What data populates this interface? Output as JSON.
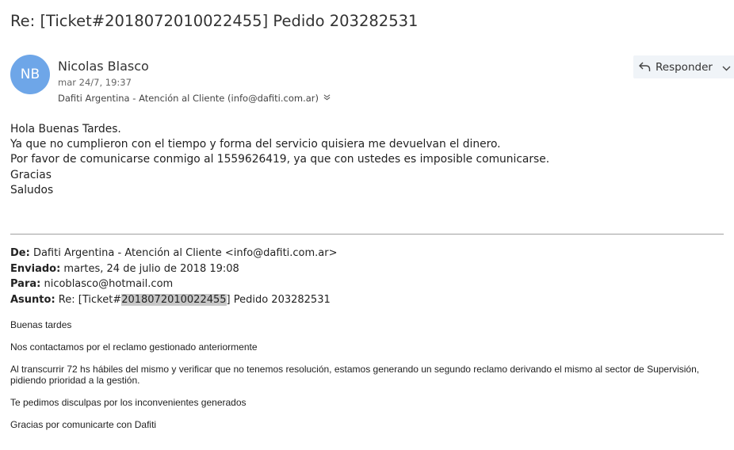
{
  "subject": "Re: [Ticket#2018072010022455] Pedido 203282531",
  "sender": {
    "initials": "NB",
    "name": "Nicolas Blasco",
    "date": "mar 24/7, 19:37",
    "to": "Dafiti Argentina - Atención al Cliente (info@dafiti.com.ar)"
  },
  "toolbar": {
    "reply_label": "Responder"
  },
  "body_lines": [
    "Hola Buenas Tardes.",
    "Ya que no cumplieron con el tiempo y forma del servicio quisiera me devuelvan el dinero.",
    "Por favor de comunicarse conmigo al 1559626419, ya que con ustedes es imposible comunicarse.",
    "Gracias",
    "Saludos"
  ],
  "quoted_header": {
    "from_label": "De:",
    "from_value": "Dafiti Argentina - Atención al Cliente <info@dafiti.com.ar>",
    "sent_label": "Enviado:",
    "sent_value": "martes, 24 de julio de 2018 19:08",
    "to_label": "Para:",
    "to_value": "nicoblasco@hotmail.com",
    "subject_label": "Asunto:",
    "subject_prefix": "Re: [Ticket#",
    "subject_highlight": "2018072010022455",
    "subject_suffix": "] Pedido 203282531"
  },
  "quoted_body": [
    "Buenas tardes",
    "Nos contactamos por el reclamo gestionado anteriormente",
    "Al transcurrir 72 hs hábiles del mismo y verificar que no tenemos resolución, estamos generando un segundo reclamo derivando el mismo al sector de Supervisión, pidiendo prioridad a la gestión.",
    "Te pedimos disculpas por los inconvenientes generados",
    "Gracias por comunicarte con Dafiti"
  ],
  "colors": {
    "avatar": "#6ea6e8",
    "reply_bg": "#f0f4f8",
    "highlight": "#c8c8c8"
  },
  "icons": [
    "reply-icon",
    "chevron-down-icon",
    "expand-recipients-icon"
  ]
}
